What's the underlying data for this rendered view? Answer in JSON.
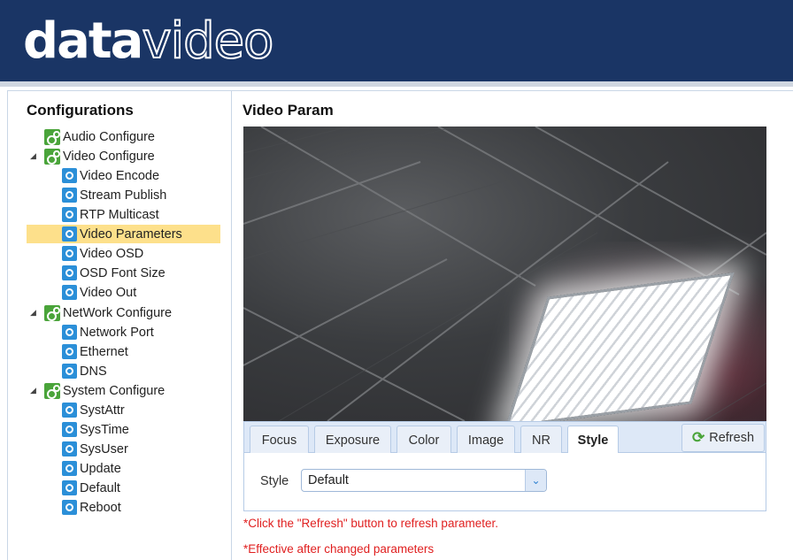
{
  "header": {
    "logo_bold": "data",
    "logo_outline": "video",
    "bg_color": "#1a3565"
  },
  "sidebar": {
    "title": "Configurations",
    "groups": [
      {
        "label": "Audio Configure",
        "items": []
      },
      {
        "label": "Video Configure",
        "items": [
          "Video Encode",
          "Stream Publish",
          "RTP Multicast",
          "Video Parameters",
          "Video OSD",
          "OSD Font Size",
          "Video Out"
        ]
      },
      {
        "label": "NetWork Configure",
        "items": [
          "Network Port",
          "Ethernet",
          "DNS"
        ]
      },
      {
        "label": "System Configure",
        "items": [
          "SystAttr",
          "SysTime",
          "SysUser",
          "Update",
          "Default",
          "Reboot"
        ]
      }
    ],
    "selected": "Video Parameters",
    "selected_color": "#fde08b"
  },
  "main": {
    "title": "Video Param",
    "tabs": [
      "Focus",
      "Exposure",
      "Color",
      "Image",
      "NR",
      "Style"
    ],
    "active_tab": "Style",
    "refresh_label": "Refresh",
    "style_field": {
      "label": "Style",
      "value": "Default"
    },
    "notes": [
      "*Click the \"Refresh\" button to refresh parameter.",
      "*Effective after changed parameters"
    ],
    "note_color": "#e02020"
  }
}
